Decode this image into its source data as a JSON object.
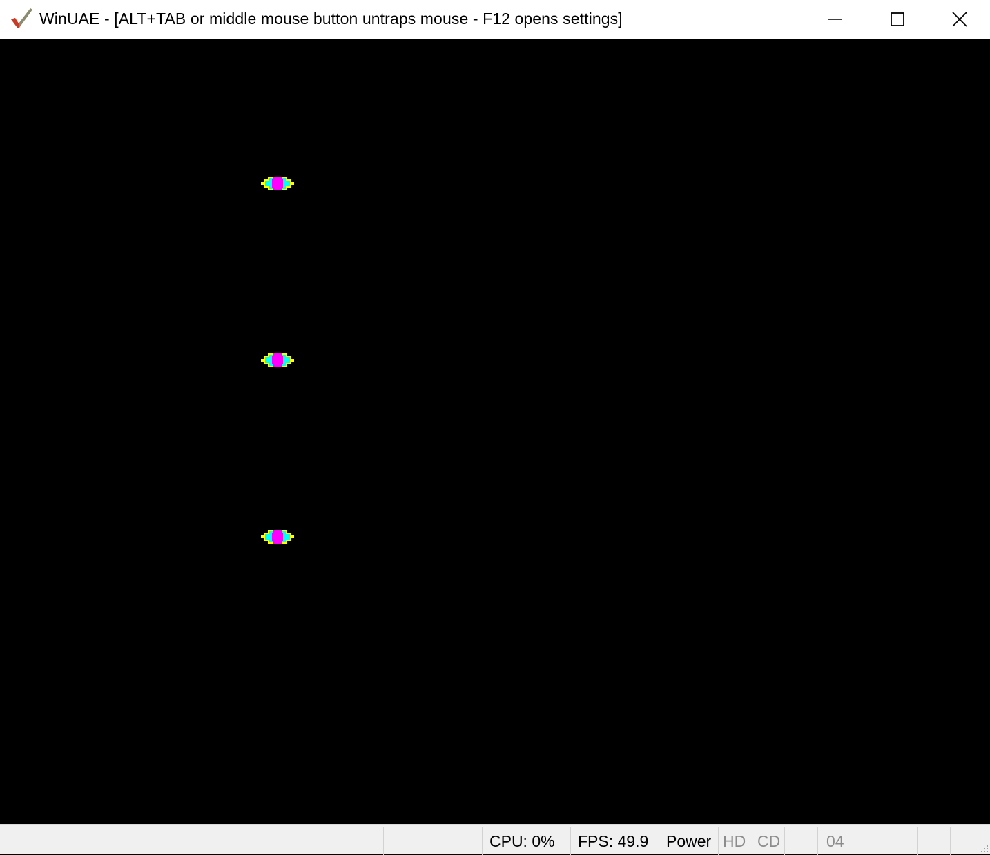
{
  "window": {
    "title": "WinUAE - [ALT+TAB or middle mouse button untraps mouse - F12 opens settings]",
    "icons": {
      "app": "winuae-checkmark-icon",
      "minimize": "minimize-icon",
      "maximize": "maximize-icon",
      "close": "close-icon"
    }
  },
  "display": {
    "background": "#000000",
    "sprites": [
      {
        "name": "sprite-1",
        "colors": [
          "#ffff00",
          "#00ffff",
          "#ff00ff"
        ]
      },
      {
        "name": "sprite-2",
        "colors": [
          "#ffff00",
          "#00ffff",
          "#ff00ff"
        ]
      },
      {
        "name": "sprite-3",
        "colors": [
          "#ffff00",
          "#00ffff",
          "#ff00ff"
        ]
      }
    ]
  },
  "statusbar": {
    "cpu": "CPU: 0%",
    "fps": "FPS: 49.9",
    "power": "Power",
    "hd": "HD",
    "cd": "CD",
    "drive": "04"
  }
}
